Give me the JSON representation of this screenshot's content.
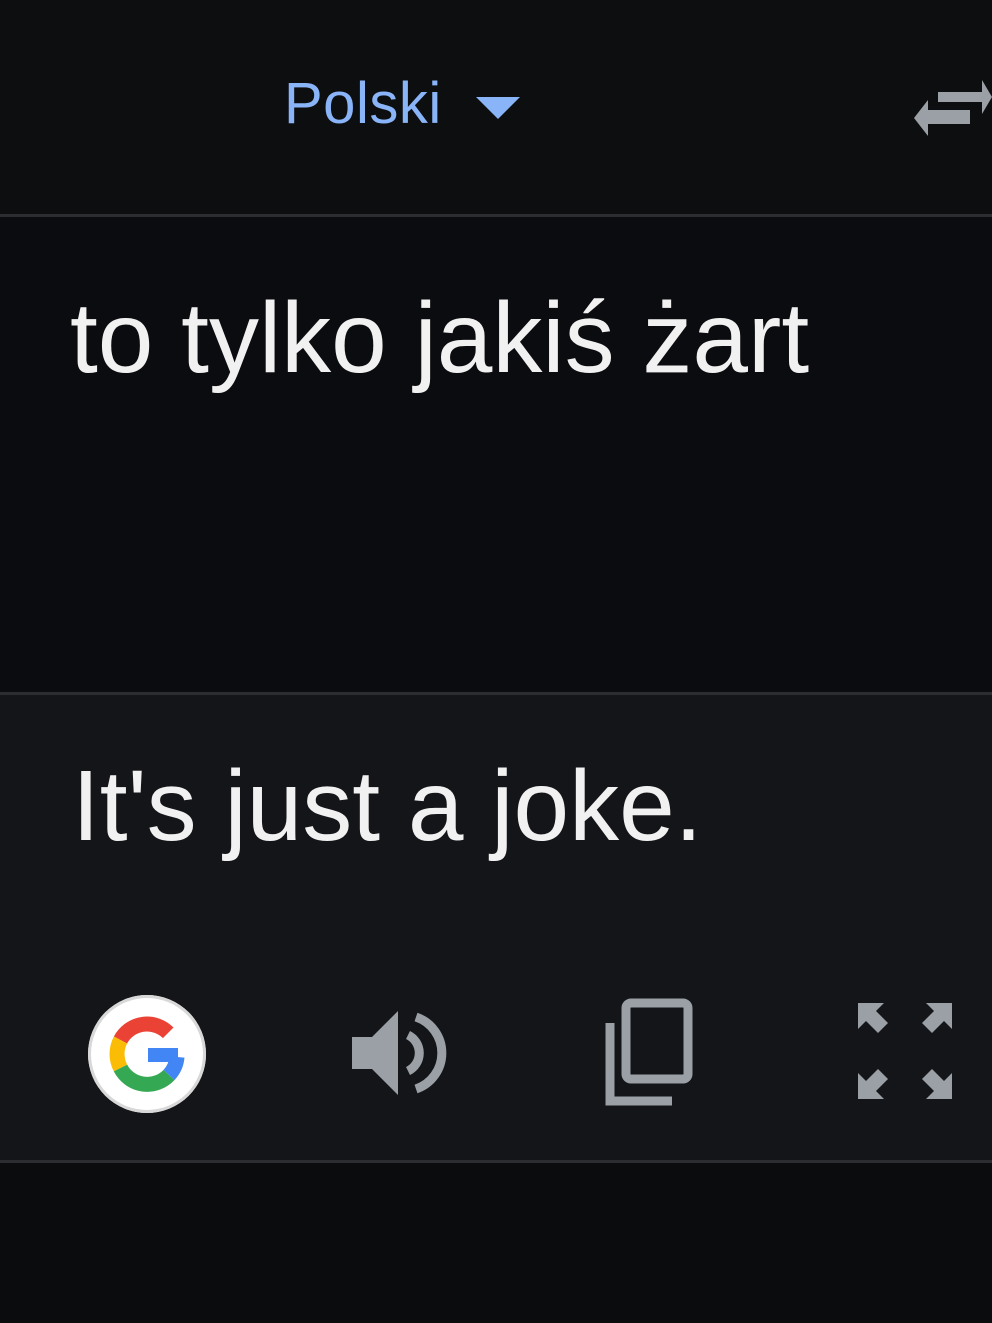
{
  "header": {
    "source_language": "Polski"
  },
  "source": {
    "text": "to tylko jakiś żart"
  },
  "result": {
    "text": "It's just a joke."
  },
  "icons": {
    "language_caret": "caret-down-icon",
    "swap": "swap-arrows-icon",
    "google": "google-g-icon",
    "speaker": "speaker-icon",
    "copy": "copy-icon",
    "fullscreen": "fullscreen-icon"
  },
  "colors": {
    "accent": "#8ab4f8",
    "text": "#f1f1f1",
    "icon": "#9aa0a6",
    "google_blue": "#4285f4",
    "google_red": "#ea4335",
    "google_yellow": "#fbbc05",
    "google_green": "#34a853"
  }
}
